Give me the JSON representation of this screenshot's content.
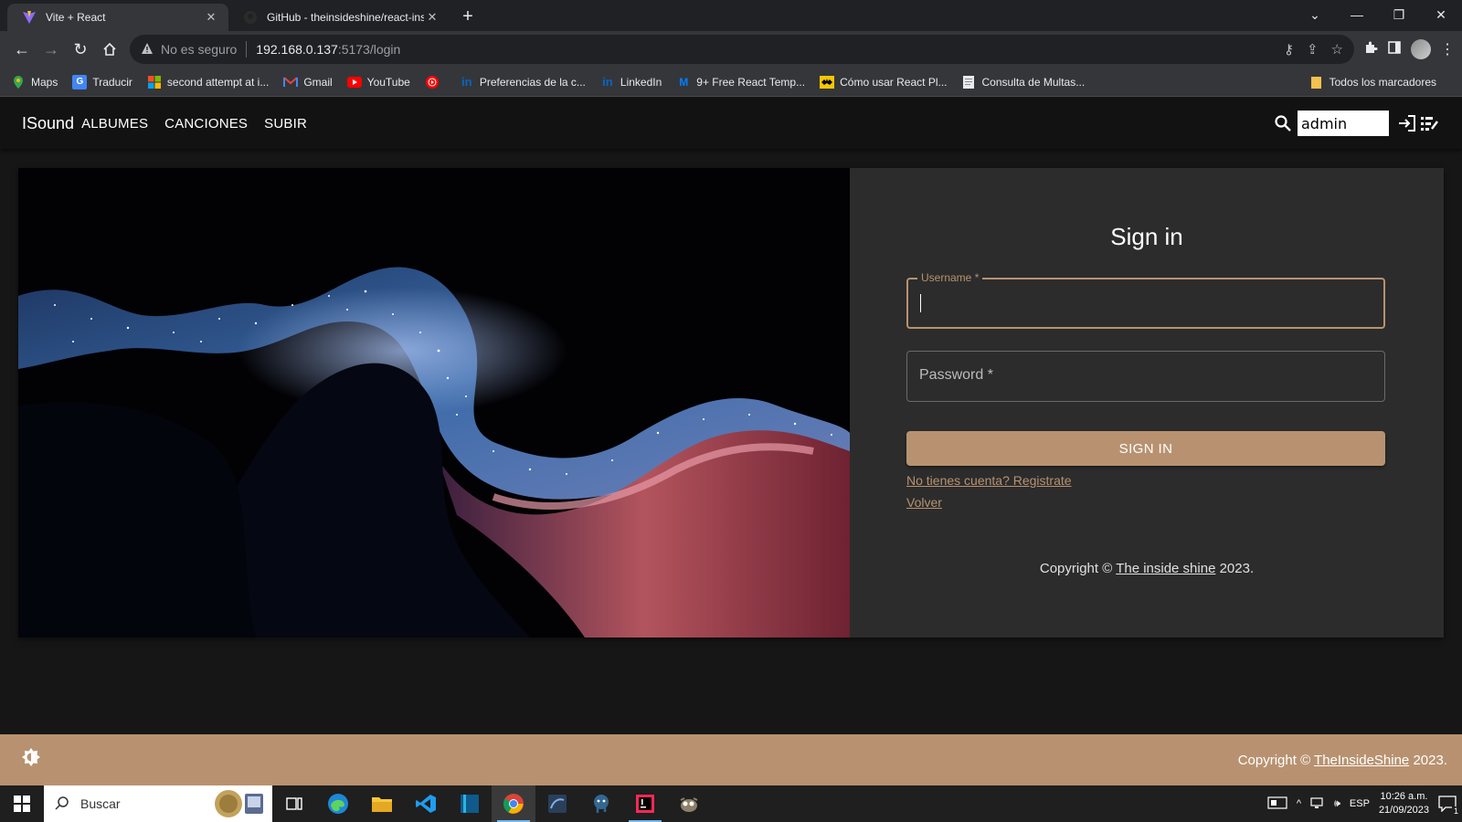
{
  "browser": {
    "tabs": [
      {
        "title": "Vite + React",
        "icon": "vite-icon",
        "active": true
      },
      {
        "title": "GitHub - theinsideshine/react-ins",
        "icon": "github-icon",
        "active": false
      }
    ],
    "security_label": "No es seguro",
    "url_host": "192.168.0.137",
    "url_rest": ":5173/login",
    "bookmarks": [
      {
        "label": "Maps",
        "icon": "maps-icon"
      },
      {
        "label": "Traducir",
        "icon": "translate-icon"
      },
      {
        "label": "second attempt at i...",
        "icon": "microsoft-icon"
      },
      {
        "label": "Gmail",
        "icon": "gmail-icon"
      },
      {
        "label": "YouTube",
        "icon": "youtube-icon"
      },
      {
        "label": "",
        "icon": "youtube-music-icon"
      },
      {
        "label": "Preferencias de la c...",
        "icon": "linkedin-icon"
      },
      {
        "label": "LinkedIn",
        "icon": "linkedin-icon"
      },
      {
        "label": "9+ Free React Temp...",
        "icon": "mui-icon"
      },
      {
        "label": "Cómo usar React Pl...",
        "icon": "batman-icon"
      },
      {
        "label": "Consulta de Multas...",
        "icon": "document-icon"
      }
    ],
    "all_bookmarks": "Todos los marcadores"
  },
  "app": {
    "brand": "ISound",
    "nav": [
      "ALBUMES",
      "CANCIONES",
      "SUBIR"
    ],
    "search_value": "admin"
  },
  "login": {
    "title": "Sign in",
    "username_label": "Username *",
    "password_label": "Password *",
    "submit_label": "SIGN IN",
    "register_link": "No tienes cuenta? Registrate",
    "back_link": "Volver",
    "copyright_prefix": "Copyright ©",
    "copyright_link": "The inside shine",
    "copyright_year": "2023."
  },
  "footer": {
    "copyright_prefix": "Copyright ©",
    "copyright_link": "TheInsideShine",
    "copyright_year": "2023."
  },
  "taskbar": {
    "search_placeholder": "Buscar",
    "language": "ESP",
    "time": "10:26 a.m.",
    "date": "21/09/2023",
    "notifications": "1"
  },
  "colors": {
    "accent": "#b89270",
    "page_bg": "#161616",
    "card_bg": "#2c2c2c",
    "appbar_bg": "#121212"
  }
}
